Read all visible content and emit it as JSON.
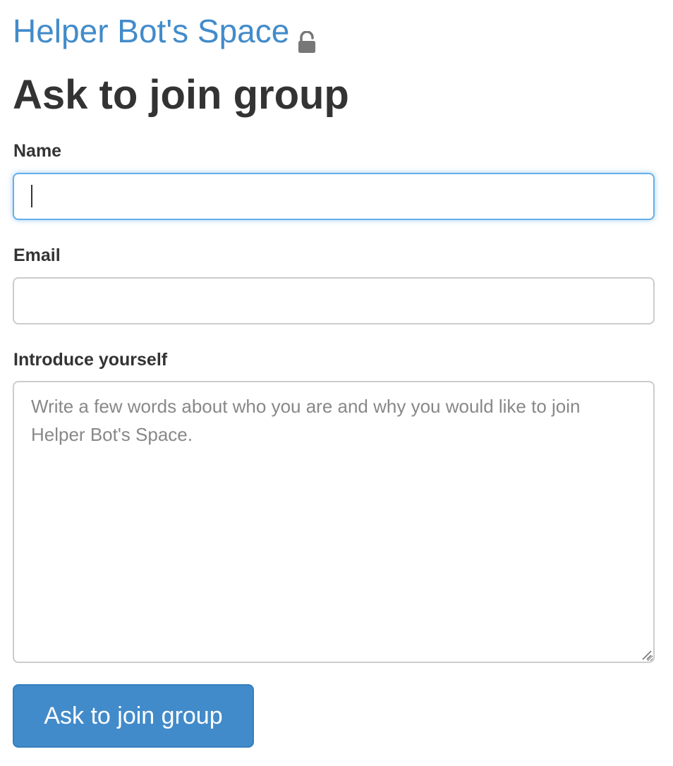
{
  "group": {
    "name": "Helper Bot's Space",
    "lock_icon": "unlocked-padlock-icon"
  },
  "page": {
    "title": "Ask to join group"
  },
  "form": {
    "name_label": "Name",
    "name_value": "",
    "email_label": "Email",
    "email_value": "",
    "intro_label": "Introduce yourself",
    "intro_placeholder": "Write a few words about who you are and why you would like to join Helper Bot's Space.",
    "submit_label": "Ask to join group"
  },
  "colors": {
    "link": "#428bca",
    "button_bg": "#428bca",
    "focus_border": "#66afe9",
    "text": "#333333"
  }
}
